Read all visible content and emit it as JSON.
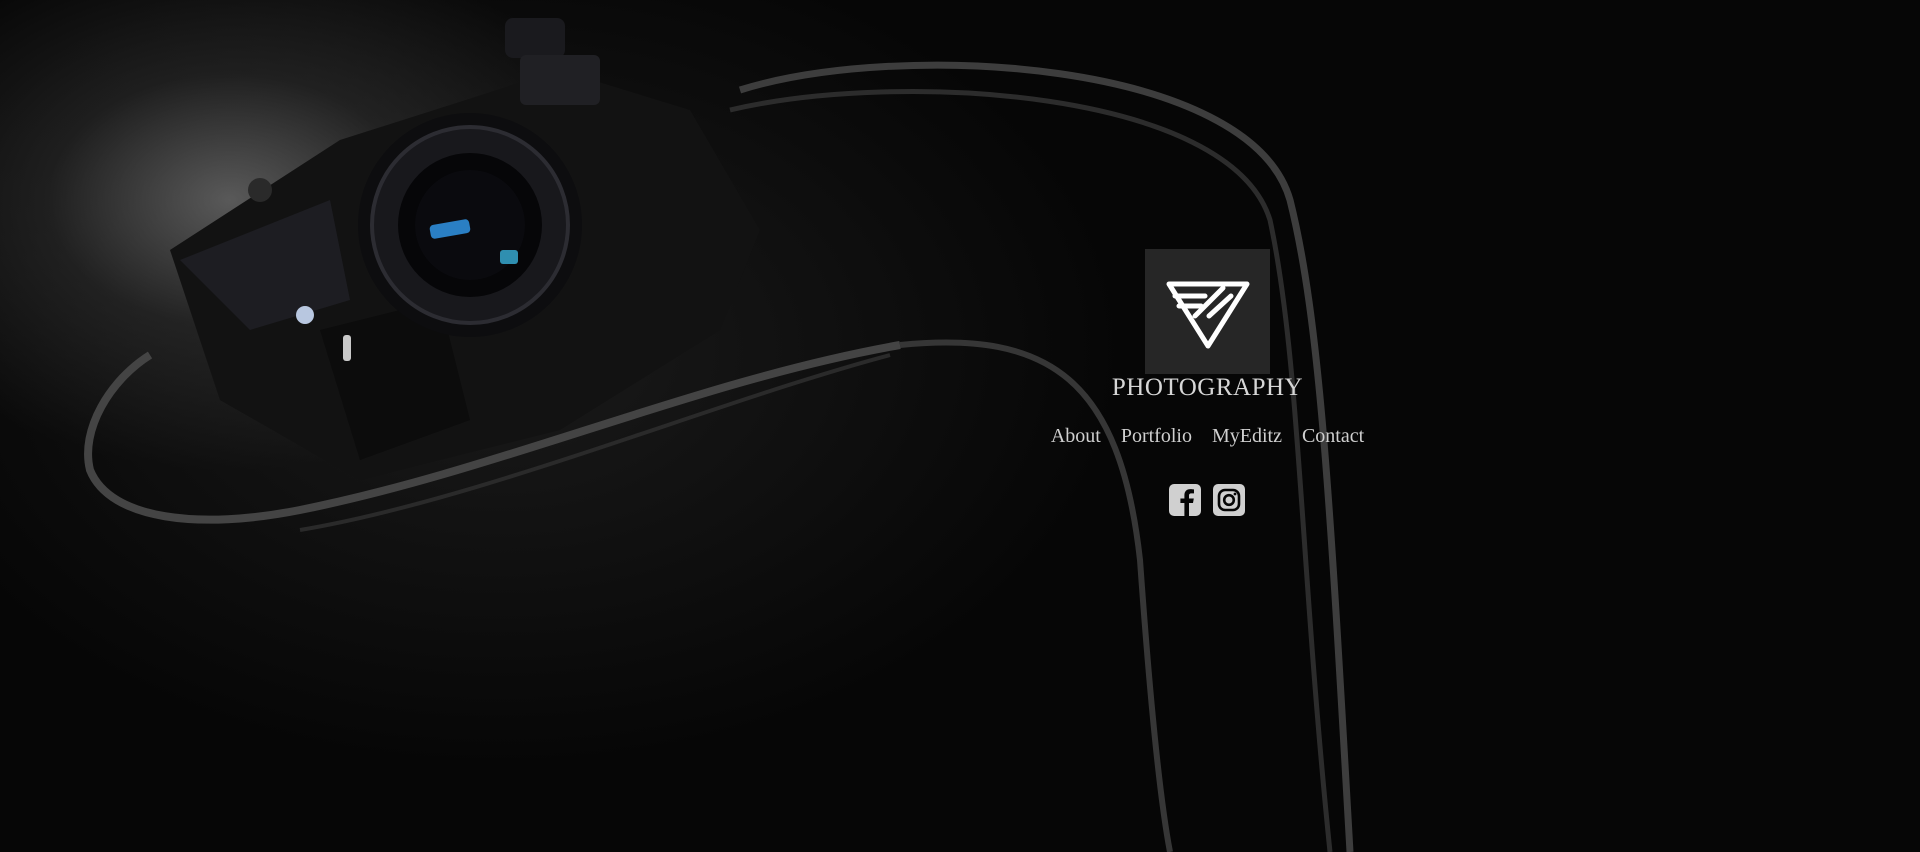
{
  "hero": {
    "background_image": "camera-with-strap",
    "accent": "#d6d6d6",
    "logo_background": "#262626"
  },
  "brand": {
    "logo_icon": "triangle-monogram-icon",
    "tagline": "PHOTOGRAPHY"
  },
  "nav": {
    "items": [
      {
        "label": "About"
      },
      {
        "label": "Portfolio"
      },
      {
        "label": "MyEditz"
      },
      {
        "label": "Contact"
      }
    ]
  },
  "social": {
    "items": [
      {
        "icon": "facebook-icon"
      },
      {
        "icon": "instagram-icon"
      }
    ]
  }
}
